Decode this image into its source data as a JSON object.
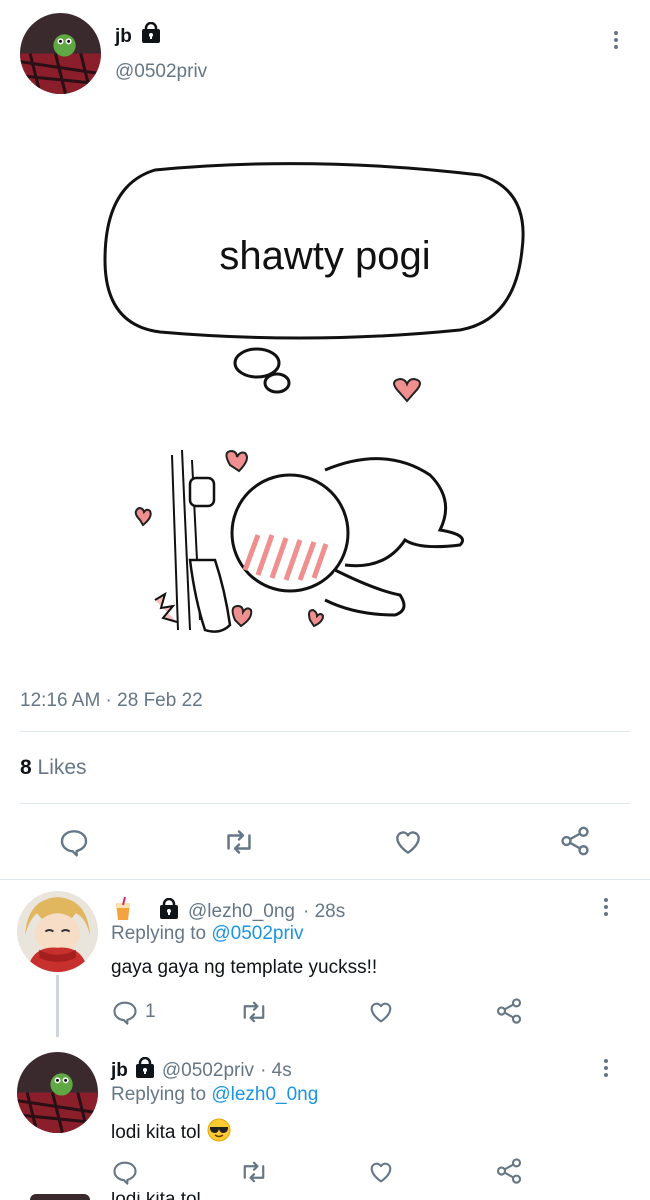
{
  "main_tweet": {
    "name": "jb",
    "handle": "@0502priv",
    "meme_text": "shawty pogi",
    "timestamp": "12:16 AM · 28 Feb 22",
    "likes_count": "8",
    "likes_label": "Likes"
  },
  "replies": [
    {
      "name": "",
      "handle": "@lezh0_0ng",
      "time": "· 28s",
      "replying_prefix": "Replying to",
      "replying_to": "@0502priv",
      "text": "gaya gaya ng template yuckss!!",
      "reply_count": "1"
    },
    {
      "name": "jb",
      "handle": "@0502priv",
      "time": "· 4s",
      "replying_prefix": "Replying to",
      "replying_to": "@lezh0_0ng",
      "text": "lodi kita tol",
      "reply_count": ""
    }
  ],
  "partial_next_text": "lodi kita tol",
  "colors": {
    "accent": "#1b95e0",
    "muted": "#657786",
    "heart": "#e0245e"
  }
}
